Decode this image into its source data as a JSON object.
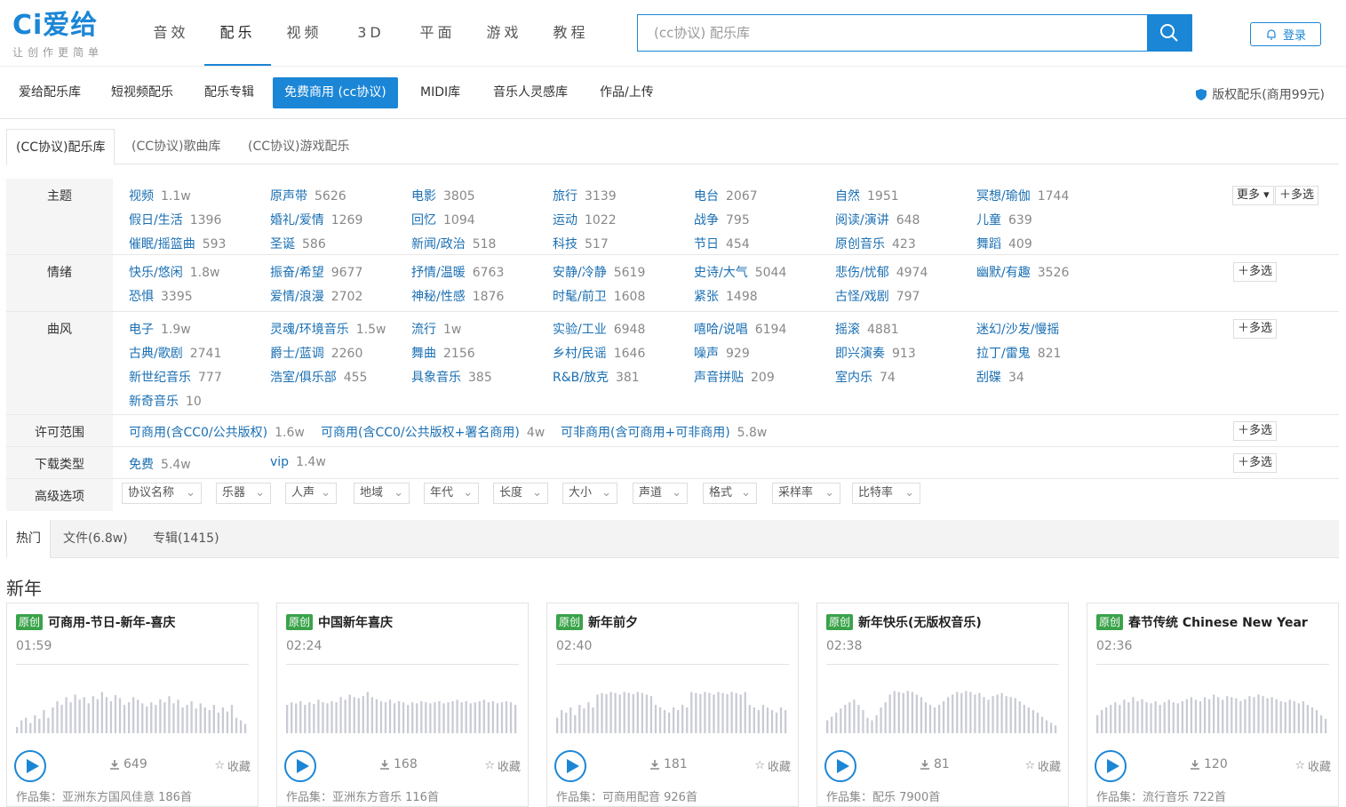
{
  "header": {
    "logo_mark": "Ci爱给",
    "slogan": "让创作更简单",
    "nav": [
      "音效",
      "配乐",
      "视频",
      "3D",
      "平面",
      "游戏",
      "教程"
    ],
    "search_placeholder": "(cc协议) 配乐库",
    "login_label": "登录"
  },
  "subnav": {
    "items": [
      "爱给配乐库",
      "短视频配乐",
      "配乐专辑",
      "免费商用 (cc协议)",
      "MIDI库",
      "音乐人灵感库",
      "作品/上传"
    ],
    "copyright": "版权配乐(商用99元)"
  },
  "ctabs": [
    "(CC协议)配乐库",
    "(CC协议)歌曲库",
    "(CC协议)游戏配乐"
  ],
  "filters": {
    "theme": {
      "label": "主题",
      "options": [
        [
          "视频",
          "1.1w"
        ],
        [
          "原声带",
          "5626"
        ],
        [
          "电影",
          "3805"
        ],
        [
          "旅行",
          "3139"
        ],
        [
          "电台",
          "2067"
        ],
        [
          "自然",
          "1951"
        ],
        [
          "冥想/瑜伽",
          "1744"
        ],
        [
          "假日/生活",
          "1396"
        ],
        [
          "婚礼/爱情",
          "1269"
        ],
        [
          "回忆",
          "1094"
        ],
        [
          "运动",
          "1022"
        ],
        [
          "战争",
          "795"
        ],
        [
          "阅读/演讲",
          "648"
        ],
        [
          "儿童",
          "639"
        ],
        [
          "催眠/摇篮曲",
          "593"
        ],
        [
          "圣诞",
          "586"
        ],
        [
          "新闻/政治",
          "518"
        ],
        [
          "科技",
          "517"
        ],
        [
          "节日",
          "454"
        ],
        [
          "原创音乐",
          "423"
        ],
        [
          "舞蹈",
          "409"
        ]
      ],
      "more_label": "更多",
      "multi_label": "多选"
    },
    "mood": {
      "label": "情绪",
      "options": [
        [
          "快乐/悠闲",
          "1.8w"
        ],
        [
          "振奋/希望",
          "9677"
        ],
        [
          "抒情/温暖",
          "6763"
        ],
        [
          "安静/冷静",
          "5619"
        ],
        [
          "史诗/大气",
          "5044"
        ],
        [
          "悲伤/忧郁",
          "4974"
        ],
        [
          "幽默/有趣",
          "3526"
        ],
        [
          "恐惧",
          "3395"
        ],
        [
          "爱情/浪漫",
          "2702"
        ],
        [
          "神秘/性感",
          "1876"
        ],
        [
          "时髦/前卫",
          "1608"
        ],
        [
          "紧张",
          "1498"
        ],
        [
          "古怪/戏剧",
          "797"
        ]
      ],
      "multi_label": "多选"
    },
    "style": {
      "label": "曲风",
      "options": [
        [
          "电子",
          "1.9w"
        ],
        [
          "灵魂/环境音乐",
          "1.5w"
        ],
        [
          "流行",
          "1w"
        ],
        [
          "实验/工业",
          "6948"
        ],
        [
          "嘻哈/说唱",
          "6194"
        ],
        [
          "摇滚",
          "4881"
        ],
        [
          "迷幻/沙发/慢摇",
          ""
        ],
        [
          "古典/歌剧",
          "2741"
        ],
        [
          "爵士/蓝调",
          "2260"
        ],
        [
          "舞曲",
          "2156"
        ],
        [
          "乡村/民谣",
          "1646"
        ],
        [
          "噪声",
          "929"
        ],
        [
          "即兴演奏",
          "913"
        ],
        [
          "拉丁/雷鬼",
          "821"
        ],
        [
          "新世纪音乐",
          "777"
        ],
        [
          "浩室/俱乐部",
          "455"
        ],
        [
          "具象音乐",
          "385"
        ],
        [
          "R&B/放克",
          "381"
        ],
        [
          "声音拼贴",
          "209"
        ],
        [
          "室内乐",
          "74"
        ],
        [
          "刮碟",
          "34"
        ],
        [
          "新奇音乐",
          "10"
        ]
      ],
      "multi_label": "多选"
    },
    "license": {
      "label": "许可范围",
      "options": [
        [
          "可商用(含CC0/公共版权)",
          "1.6w"
        ],
        [
          "可商用(含CC0/公共版权+署名商用)",
          "4w"
        ],
        [
          "可非商用(含可商用+可非商用)",
          "5.8w"
        ]
      ],
      "multi_label": "多选"
    },
    "download": {
      "label": "下载类型",
      "options": [
        [
          "免费",
          "5.4w"
        ],
        [
          "vip",
          "1.4w"
        ]
      ],
      "multi_label": "多选"
    },
    "advanced": {
      "label": "高级选项",
      "dropdowns": [
        "协议名称",
        "乐器",
        "人声",
        "地域",
        "年代",
        "长度",
        "大小",
        "声道",
        "格式",
        "采样率",
        "比特率"
      ]
    }
  },
  "htabs": [
    "热门",
    "文件(6.8w)",
    "专辑(1415)"
  ],
  "section_title": "新年",
  "cards": [
    {
      "badge": "原创",
      "title": "可商用-节日-新年-喜庆",
      "duration": "01:59",
      "downloads": "649",
      "fav": "收藏",
      "album": "作品集：亚洲东方国风佳意 186首",
      "wave": [
        0.12,
        0.25,
        0.3,
        0.2,
        0.35,
        0.28,
        0.45,
        0.3,
        0.5,
        0.62,
        0.55,
        0.7,
        0.6,
        0.75,
        0.65,
        0.7,
        0.58,
        0.72,
        0.66,
        0.8,
        0.7,
        0.62,
        0.74,
        0.68,
        0.55,
        0.6,
        0.7,
        0.65,
        0.58,
        0.52,
        0.6,
        0.55,
        0.66,
        0.6,
        0.72,
        0.58,
        0.65,
        0.5,
        0.55,
        0.62,
        0.48,
        0.58,
        0.5,
        0.45,
        0.55,
        0.4,
        0.5,
        0.42,
        0.55,
        0.3,
        0.25,
        0.18
      ]
    },
    {
      "badge": "原创",
      "title": "中国新年喜庆",
      "duration": "02:24",
      "downloads": "168",
      "fav": "收藏",
      "album": "作品集：亚洲东方音乐 116首",
      "wave": [
        0.55,
        0.6,
        0.58,
        0.62,
        0.55,
        0.6,
        0.57,
        0.65,
        0.6,
        0.58,
        0.62,
        0.6,
        0.7,
        0.65,
        0.75,
        0.7,
        0.68,
        0.72,
        0.8,
        0.7,
        0.66,
        0.62,
        0.6,
        0.65,
        0.58,
        0.62,
        0.6,
        0.55,
        0.6,
        0.58,
        0.62,
        0.6,
        0.58,
        0.6,
        0.62,
        0.58,
        0.6,
        0.62,
        0.65,
        0.6,
        0.62,
        0.58,
        0.6,
        0.62,
        0.65,
        0.6,
        0.62,
        0.58,
        0.6,
        0.62,
        0.6,
        0.55
      ]
    },
    {
      "badge": "原创",
      "title": "新年前夕",
      "duration": "02:40",
      "downloads": "181",
      "fav": "收藏",
      "album": "作品集：可商用配音 926首",
      "wave": [
        0.3,
        0.45,
        0.4,
        0.5,
        0.35,
        0.55,
        0.48,
        0.6,
        0.5,
        0.75,
        0.78,
        0.76,
        0.8,
        0.78,
        0.75,
        0.8,
        0.78,
        0.76,
        0.8,
        0.78,
        0.75,
        0.72,
        0.55,
        0.5,
        0.45,
        0.4,
        0.5,
        0.45,
        0.55,
        0.5,
        0.8,
        0.78,
        0.76,
        0.8,
        0.78,
        0.75,
        0.8,
        0.78,
        0.76,
        0.8,
        0.78,
        0.75,
        0.8,
        0.55,
        0.5,
        0.45,
        0.55,
        0.5,
        0.45,
        0.4,
        0.5,
        0.45
      ]
    },
    {
      "badge": "原创",
      "title": "新年快乐(无版权音乐)",
      "duration": "02:38",
      "downloads": "81",
      "fav": "收藏",
      "album": "作品集：配乐 7900首",
      "wave": [
        0.25,
        0.32,
        0.4,
        0.48,
        0.55,
        0.6,
        0.65,
        0.55,
        0.45,
        0.3,
        0.25,
        0.35,
        0.5,
        0.6,
        0.75,
        0.82,
        0.8,
        0.78,
        0.82,
        0.8,
        0.75,
        0.7,
        0.6,
        0.55,
        0.5,
        0.55,
        0.62,
        0.7,
        0.75,
        0.8,
        0.78,
        0.82,
        0.8,
        0.75,
        0.78,
        0.7,
        0.65,
        0.72,
        0.75,
        0.78,
        0.72,
        0.7,
        0.68,
        0.62,
        0.55,
        0.5,
        0.45,
        0.4,
        0.32,
        0.25,
        0.2,
        0.15
      ]
    },
    {
      "badge": "原创",
      "title": "春节传统 Chinese New Year",
      "duration": "02:36",
      "downloads": "120",
      "fav": "收藏",
      "album": "作品集：流行音乐 722首",
      "wave": [
        0.35,
        0.45,
        0.5,
        0.55,
        0.6,
        0.55,
        0.65,
        0.6,
        0.7,
        0.62,
        0.66,
        0.6,
        0.58,
        0.62,
        0.55,
        0.6,
        0.65,
        0.6,
        0.58,
        0.62,
        0.66,
        0.7,
        0.65,
        0.62,
        0.7,
        0.66,
        0.75,
        0.7,
        0.65,
        0.72,
        0.7,
        0.68,
        0.62,
        0.66,
        0.72,
        0.7,
        0.75,
        0.72,
        0.68,
        0.7,
        0.66,
        0.62,
        0.6,
        0.65,
        0.62,
        0.58,
        0.62,
        0.55,
        0.5,
        0.45,
        0.35,
        0.28
      ]
    }
  ]
}
